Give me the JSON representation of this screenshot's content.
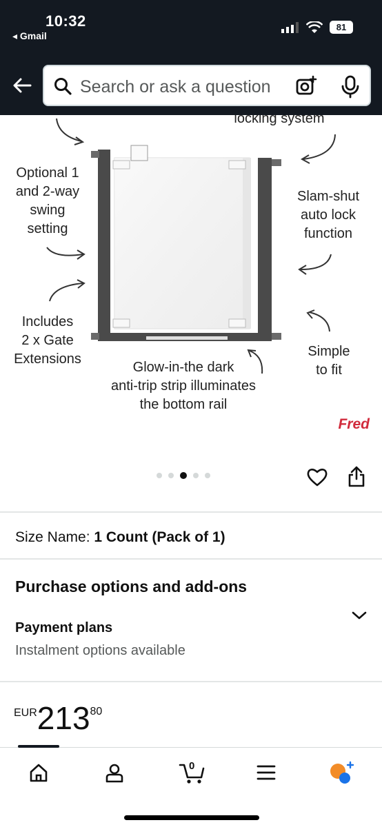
{
  "status": {
    "time": "10:32",
    "back_app": "◂ Gmail",
    "battery": "81"
  },
  "search": {
    "placeholder": "Search or ask a question"
  },
  "product_image": {
    "annotations": {
      "top_cut": "locking system",
      "swing": "Optional 1\nand 2-way\nswing\nsetting",
      "slam": "Slam-shut\nauto lock\nfunction",
      "extensions": "Includes\n2 x Gate\nExtensions",
      "fit": "Simple\nto fit",
      "strip": "Glow-in-the dark\nanti-trip strip illuminates\nthe bottom rail"
    },
    "brand": "Fred",
    "carousel_count": 5,
    "carousel_active": 3
  },
  "size": {
    "label": "Size Name:",
    "value": "1 Count (Pack of 1)"
  },
  "purchase": {
    "title": "Purchase options and add-ons",
    "plans_title": "Payment plans",
    "plans_sub": "Instalment options available"
  },
  "price": {
    "currency": "EUR",
    "whole": "213",
    "fraction": "80"
  },
  "bottom_nav": {
    "items": [
      "home-icon",
      "account-icon",
      "cart-icon",
      "menu-icon",
      "assistant-icon"
    ],
    "cart_count": "0"
  },
  "colors": {
    "header_bg": "#131921",
    "brand_red": "#d12b3c",
    "text_secondary": "#565959"
  }
}
